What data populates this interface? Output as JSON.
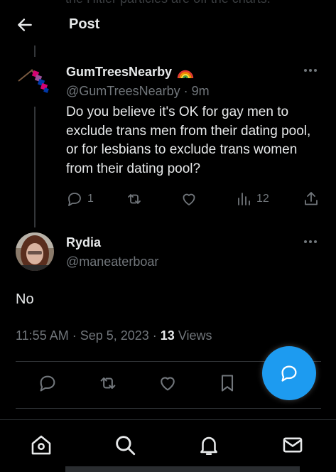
{
  "header": {
    "back_icon": "arrow-left-icon",
    "title": "Post",
    "ghost_text": "the Hitler particles are off the charts."
  },
  "parent_post": {
    "author_name": "GumTreesNearby",
    "author_badge_icon": "rainbow-emoji-icon",
    "handle": "@GumTreesNearby",
    "time": "9m",
    "text": "Do you believe it's OK for gay men to exclude trans men from their dating pool, or for lesbians to exclude trans women from their dating pool?",
    "reply_count": "1",
    "repost_count": "",
    "like_count": "",
    "view_count": "12"
  },
  "focal_post": {
    "author_name": "Rydia",
    "handle": "@maneaterboar",
    "text": "No",
    "timestamp": "11:55 AM · Sep 5, 2023",
    "separator": " · ",
    "views_count": "13",
    "views_label": "Views"
  },
  "colors": {
    "background": "#000000",
    "primary_text": "#e7e9ea",
    "secondary_text": "#71767b",
    "accent": "#1d9bf0",
    "divider": "#2f3336"
  },
  "bottom_nav": [
    "home-icon",
    "search-icon",
    "bell-icon",
    "mail-icon"
  ]
}
